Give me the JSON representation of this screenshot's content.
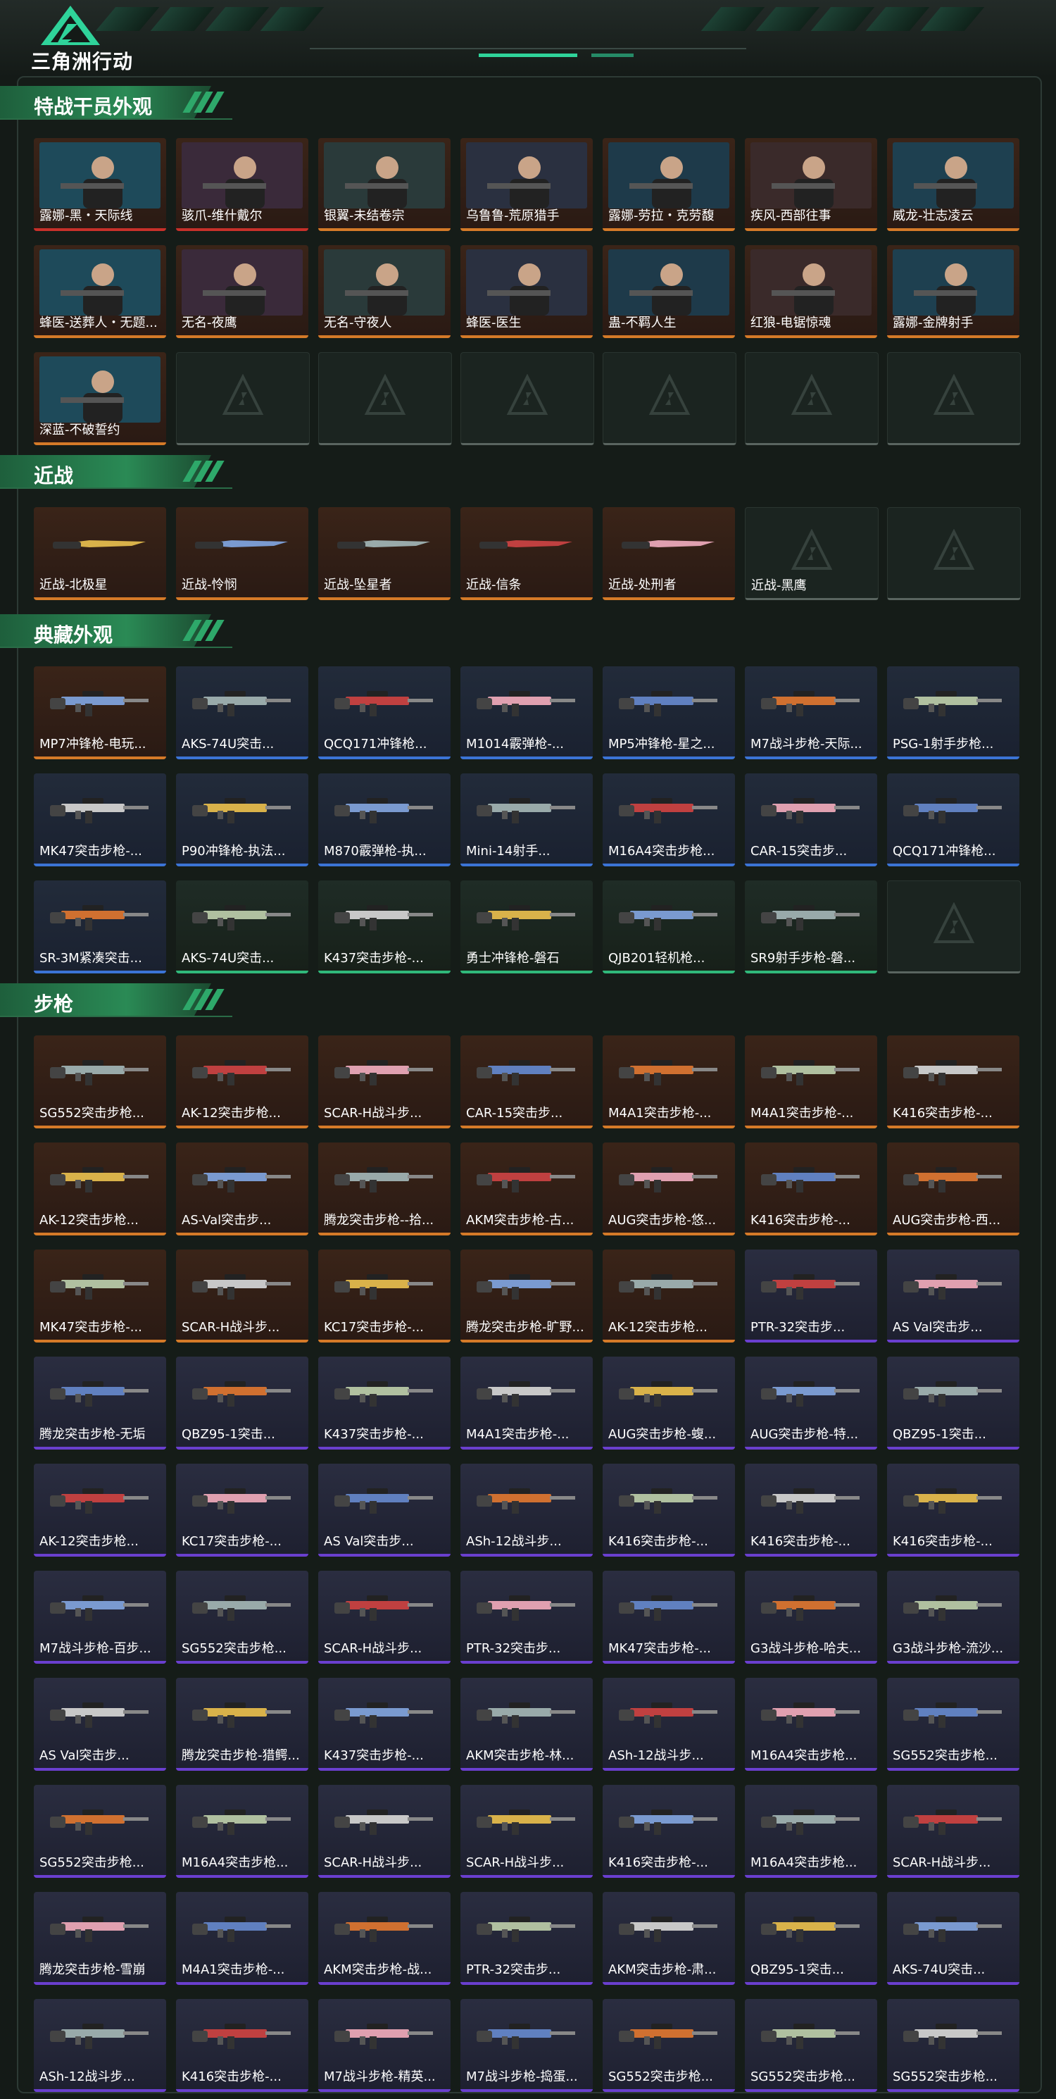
{
  "app": {
    "title": "三角洲行动"
  },
  "colors": {
    "accent": "#2fd39a",
    "gold": "#d57a28",
    "purple": "#6a3fcf",
    "blue": "#3b74d6",
    "green": "#30b87a",
    "red": "#c8302a"
  },
  "sections": [
    {
      "title": "特战干员外观",
      "items": [
        {
          "label": "露娜-黑・天际线",
          "rarity": "red"
        },
        {
          "label": "骇爪-维什戴尔",
          "rarity": "red"
        },
        {
          "label": "银翼-未结卷宗",
          "rarity": "gold"
        },
        {
          "label": "乌鲁鲁-荒原猎手",
          "rarity": "gold"
        },
        {
          "label": "露娜-劳拉・克劳馥",
          "rarity": "gold"
        },
        {
          "label": "疾风-西部往事",
          "rarity": "gold"
        },
        {
          "label": "威龙-壮志凌云",
          "rarity": "gold"
        },
        {
          "label": "蜂医-送葬人・无题...",
          "rarity": "gold"
        },
        {
          "label": "无名-夜鹰",
          "rarity": "gold"
        },
        {
          "label": "无名-守夜人",
          "rarity": "gold"
        },
        {
          "label": "蜂医-医生",
          "rarity": "gold"
        },
        {
          "label": "蛊-不羁人生",
          "rarity": "gold"
        },
        {
          "label": "红狼-电锯惊魂",
          "rarity": "gold"
        },
        {
          "label": "露娜-金牌射手",
          "rarity": "gold"
        },
        {
          "label": "深蓝-不破誓约",
          "rarity": "gold"
        },
        {
          "label": "",
          "rarity": "empty"
        },
        {
          "label": "",
          "rarity": "empty"
        },
        {
          "label": "",
          "rarity": "empty"
        },
        {
          "label": "",
          "rarity": "empty"
        },
        {
          "label": "",
          "rarity": "empty"
        },
        {
          "label": "",
          "rarity": "empty"
        }
      ]
    },
    {
      "title": "近战",
      "items": [
        {
          "label": "近战-北极星",
          "rarity": "gold"
        },
        {
          "label": "近战-怜悯",
          "rarity": "gold"
        },
        {
          "label": "近战-坠星者",
          "rarity": "gold"
        },
        {
          "label": "近战-信条",
          "rarity": "gold"
        },
        {
          "label": "近战-处刑者",
          "rarity": "gold"
        },
        {
          "label": "近战-黑鹰",
          "rarity": "empty"
        },
        {
          "label": "",
          "rarity": "empty"
        }
      ]
    },
    {
      "title": "典藏外观",
      "items": [
        {
          "label": "MP7冲锋枪-电玩...",
          "rarity": "gold"
        },
        {
          "label": "AKS-74U突击...",
          "rarity": "blue"
        },
        {
          "label": "QCQ171冲锋枪...",
          "rarity": "blue"
        },
        {
          "label": "M1014霰弹枪-...",
          "rarity": "blue"
        },
        {
          "label": "MP5冲锋枪-星之...",
          "rarity": "blue"
        },
        {
          "label": "M7战斗步枪-天际...",
          "rarity": "blue"
        },
        {
          "label": "PSG-1射手步枪...",
          "rarity": "blue"
        },
        {
          "label": "MK47突击步枪-...",
          "rarity": "blue"
        },
        {
          "label": "P90冲锋枪-执法...",
          "rarity": "blue"
        },
        {
          "label": "M870霰弹枪-执...",
          "rarity": "blue"
        },
        {
          "label": "Mini-14射手...",
          "rarity": "blue"
        },
        {
          "label": "M16A4突击步枪...",
          "rarity": "blue"
        },
        {
          "label": "CAR-15突击步...",
          "rarity": "blue"
        },
        {
          "label": "QCQ171冲锋枪...",
          "rarity": "blue"
        },
        {
          "label": "SR-3M紧凑突击...",
          "rarity": "blue"
        },
        {
          "label": "AKS-74U突击...",
          "rarity": "green"
        },
        {
          "label": "K437突击步枪-...",
          "rarity": "green"
        },
        {
          "label": "勇士冲锋枪-磐石",
          "rarity": "green"
        },
        {
          "label": "QJB201轻机枪...",
          "rarity": "green"
        },
        {
          "label": "SR9射手步枪-磐...",
          "rarity": "green"
        },
        {
          "label": "",
          "rarity": "empty"
        }
      ]
    },
    {
      "title": "步枪",
      "items": [
        {
          "label": "SG552突击步枪...",
          "rarity": "gold"
        },
        {
          "label": "AK-12突击步枪...",
          "rarity": "gold"
        },
        {
          "label": "SCAR-H战斗步...",
          "rarity": "gold"
        },
        {
          "label": "CAR-15突击步...",
          "rarity": "gold"
        },
        {
          "label": "M4A1突击步枪-...",
          "rarity": "gold"
        },
        {
          "label": "M4A1突击步枪-...",
          "rarity": "gold"
        },
        {
          "label": "K416突击步枪-...",
          "rarity": "gold"
        },
        {
          "label": "AK-12突击步枪...",
          "rarity": "gold"
        },
        {
          "label": "AS-Val突击步...",
          "rarity": "gold"
        },
        {
          "label": "腾龙突击步枪--拾...",
          "rarity": "gold"
        },
        {
          "label": "AKM突击步枪-古...",
          "rarity": "gold"
        },
        {
          "label": "AUG突击步枪-悠...",
          "rarity": "gold"
        },
        {
          "label": "K416突击步枪-...",
          "rarity": "gold"
        },
        {
          "label": "AUG突击步枪-西...",
          "rarity": "gold"
        },
        {
          "label": "MK47突击步枪-...",
          "rarity": "gold"
        },
        {
          "label": "SCAR-H战斗步...",
          "rarity": "gold"
        },
        {
          "label": "KC17突击步枪-...",
          "rarity": "gold"
        },
        {
          "label": "腾龙突击步枪-旷野...",
          "rarity": "gold"
        },
        {
          "label": "AK-12突击步枪...",
          "rarity": "gold"
        },
        {
          "label": "PTR-32突击步...",
          "rarity": "purple"
        },
        {
          "label": "AS Val突击步...",
          "rarity": "purple"
        },
        {
          "label": "腾龙突击步枪-无垢",
          "rarity": "purple"
        },
        {
          "label": "QBZ95-1突击...",
          "rarity": "purple"
        },
        {
          "label": "K437突击步枪-...",
          "rarity": "purple"
        },
        {
          "label": "M4A1突击步枪-...",
          "rarity": "purple"
        },
        {
          "label": "AUG突击步枪-蝮...",
          "rarity": "purple"
        },
        {
          "label": "AUG突击步枪-特...",
          "rarity": "purple"
        },
        {
          "label": "QBZ95-1突击...",
          "rarity": "purple"
        },
        {
          "label": "AK-12突击步枪...",
          "rarity": "purple"
        },
        {
          "label": "KC17突击步枪-...",
          "rarity": "purple"
        },
        {
          "label": "AS Val突击步...",
          "rarity": "purple"
        },
        {
          "label": "ASh-12战斗步...",
          "rarity": "purple"
        },
        {
          "label": "K416突击步枪-...",
          "rarity": "purple"
        },
        {
          "label": "K416突击步枪-...",
          "rarity": "purple"
        },
        {
          "label": "K416突击步枪-...",
          "rarity": "purple"
        },
        {
          "label": "M7战斗步枪-百步...",
          "rarity": "purple"
        },
        {
          "label": "SG552突击步枪...",
          "rarity": "purple"
        },
        {
          "label": "SCAR-H战斗步...",
          "rarity": "purple"
        },
        {
          "label": "PTR-32突击步...",
          "rarity": "purple"
        },
        {
          "label": "MK47突击步枪-...",
          "rarity": "purple"
        },
        {
          "label": "G3战斗步枪-哈夫...",
          "rarity": "purple"
        },
        {
          "label": "G3战斗步枪-流沙...",
          "rarity": "purple"
        },
        {
          "label": "AS Val突击步...",
          "rarity": "purple"
        },
        {
          "label": "腾龙突击步枪-猎鳄...",
          "rarity": "purple"
        },
        {
          "label": "K437突击步枪-...",
          "rarity": "purple"
        },
        {
          "label": "AKM突击步枪-林...",
          "rarity": "purple"
        },
        {
          "label": "ASh-12战斗步...",
          "rarity": "purple"
        },
        {
          "label": "M16A4突击步枪...",
          "rarity": "purple"
        },
        {
          "label": "SG552突击步枪...",
          "rarity": "purple"
        },
        {
          "label": "SG552突击步枪...",
          "rarity": "purple"
        },
        {
          "label": "M16A4突击步枪...",
          "rarity": "purple"
        },
        {
          "label": "SCAR-H战斗步...",
          "rarity": "purple"
        },
        {
          "label": "SCAR-H战斗步...",
          "rarity": "purple"
        },
        {
          "label": "K416突击步枪-...",
          "rarity": "purple"
        },
        {
          "label": "M16A4突击步枪...",
          "rarity": "purple"
        },
        {
          "label": "SCAR-H战斗步...",
          "rarity": "purple"
        },
        {
          "label": "腾龙突击步枪-雪崩",
          "rarity": "purple"
        },
        {
          "label": "M4A1突击步枪-...",
          "rarity": "purple"
        },
        {
          "label": "AKM突击步枪-战...",
          "rarity": "purple"
        },
        {
          "label": "PTR-32突击步...",
          "rarity": "purple"
        },
        {
          "label": "AKM突击步枪-肃...",
          "rarity": "purple"
        },
        {
          "label": "QBZ95-1突击...",
          "rarity": "purple"
        },
        {
          "label": "AKS-74U突击...",
          "rarity": "purple"
        },
        {
          "label": "ASh-12战斗步...",
          "rarity": "purple"
        },
        {
          "label": "K416突击步枪-...",
          "rarity": "purple"
        },
        {
          "label": "M7战斗步枪-精英...",
          "rarity": "purple"
        },
        {
          "label": "M7战斗步枪-捣蛋...",
          "rarity": "purple"
        },
        {
          "label": "SG552突击步枪...",
          "rarity": "purple"
        },
        {
          "label": "SG552突击步枪...",
          "rarity": "purple"
        },
        {
          "label": "SG552突击步枪...",
          "rarity": "purple"
        }
      ]
    }
  ]
}
